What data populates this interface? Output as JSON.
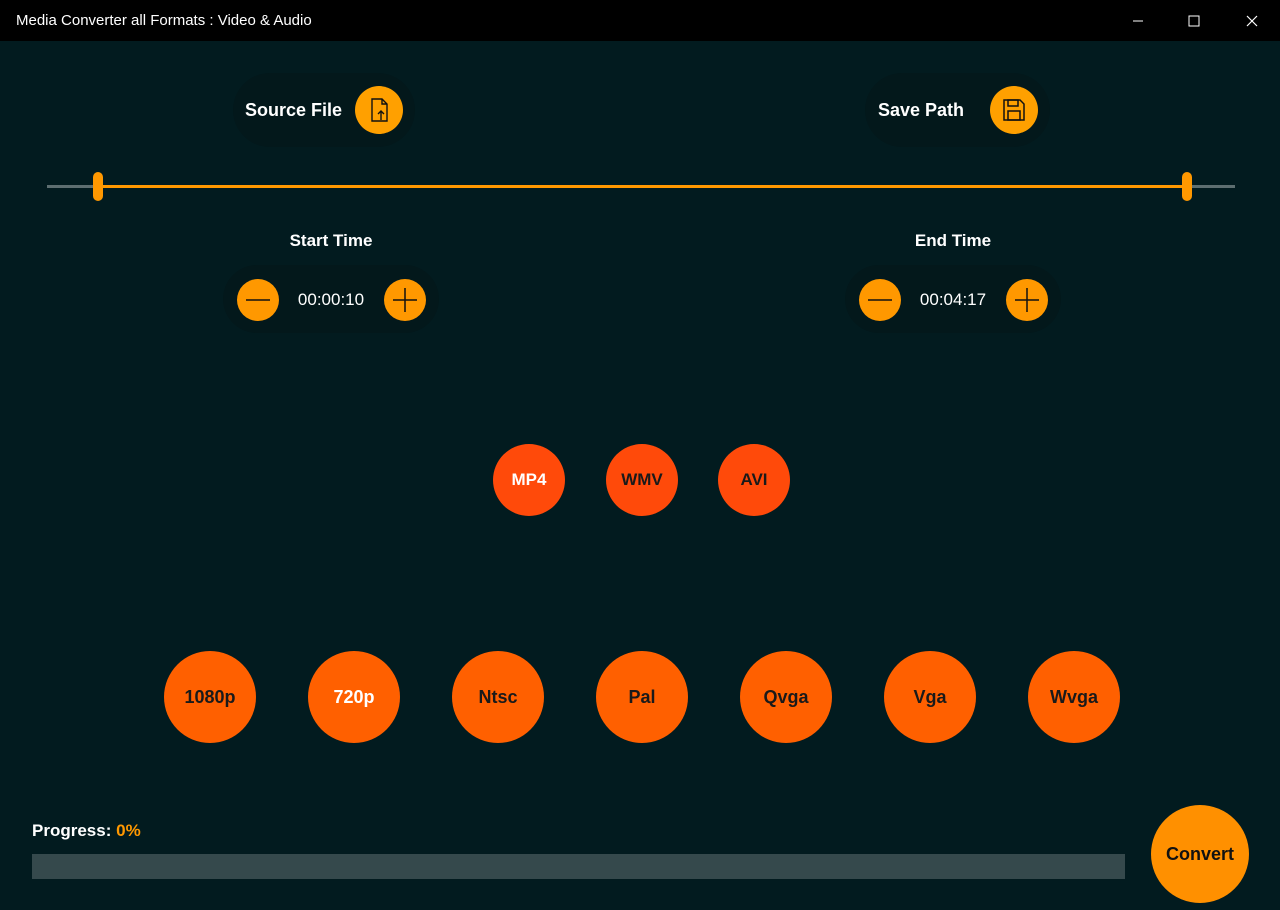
{
  "window": {
    "title": "Media Converter all Formats : Video & Audio",
    "controls": [
      "minimize-icon",
      "maximize-icon",
      "close-icon"
    ]
  },
  "actions": {
    "source_file_label": "Source File",
    "source_file_icon": "file-upload-icon",
    "save_path_label": "Save Path",
    "save_path_icon": "save-disk-icon"
  },
  "trim_range": {
    "start_fraction": 0.043,
    "end_fraction": 0.96
  },
  "start_time": {
    "label": "Start Time",
    "value": "00:00:10"
  },
  "end_time": {
    "label": "End Time",
    "value": "00:04:17"
  },
  "formats": [
    {
      "label": "MP4",
      "text_color": "#ffffff"
    },
    {
      "label": "WMV",
      "text_color": "#1a1a1a"
    },
    {
      "label": "AVI",
      "text_color": "#1a1a1a"
    }
  ],
  "resolutions": [
    {
      "label": "1080p",
      "text_color": "#1a1a1a"
    },
    {
      "label": "720p",
      "text_color": "#ffffff"
    },
    {
      "label": "Ntsc",
      "text_color": "#1a1a1a"
    },
    {
      "label": "Pal",
      "text_color": "#1a1a1a"
    },
    {
      "label": "Qvga",
      "text_color": "#1a1a1a"
    },
    {
      "label": "Vga",
      "text_color": "#1a1a1a"
    },
    {
      "label": "Wvga",
      "text_color": "#1a1a1a"
    }
  ],
  "progress": {
    "label": "Progress:",
    "value_text": "0%",
    "fraction": 0
  },
  "convert_label": "Convert",
  "colors": {
    "background": "#021b1f",
    "accent": "#ff9800",
    "format_button": "#ff4a0a",
    "resolution_button": "#ff6000"
  }
}
